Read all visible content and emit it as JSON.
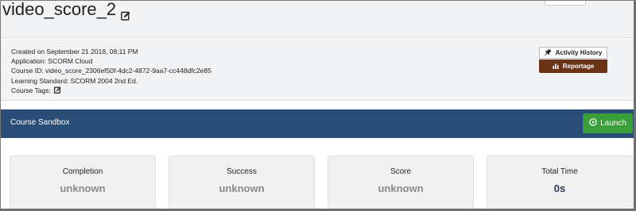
{
  "course": {
    "title": "video_score_2",
    "edit_icon": "edit-icon"
  },
  "info": {
    "created": "Created on September 21 2018, 08:11 PM",
    "application": "Application: SCORM Cloud",
    "course_id": "Course ID: video_score_2306ef50f-4dc2-4872-9aa7-cc448dfc2e85",
    "learning_standard": "Learning Standard: SCORM 2004 2nd Ed.",
    "course_tags": "Course Tags:"
  },
  "actions": {
    "activity_history": "Activity History",
    "reportage": "Reportage"
  },
  "sandbox": {
    "title": "Course Sandbox",
    "launch": "Launch"
  },
  "stats": [
    {
      "label": "Completion",
      "value": "unknown"
    },
    {
      "label": "Success",
      "value": "unknown"
    },
    {
      "label": "Score",
      "value": "unknown"
    },
    {
      "label": "Total Time",
      "value": "0s"
    }
  ],
  "colors": {
    "header_bg": "#f2f3f5",
    "sandbox_bar": "#2a4d78",
    "launch": "#3a9e3a",
    "reportage": "#6b3416",
    "value_unknown": "#8a8a8a",
    "value_time": "#2a3e5c"
  }
}
